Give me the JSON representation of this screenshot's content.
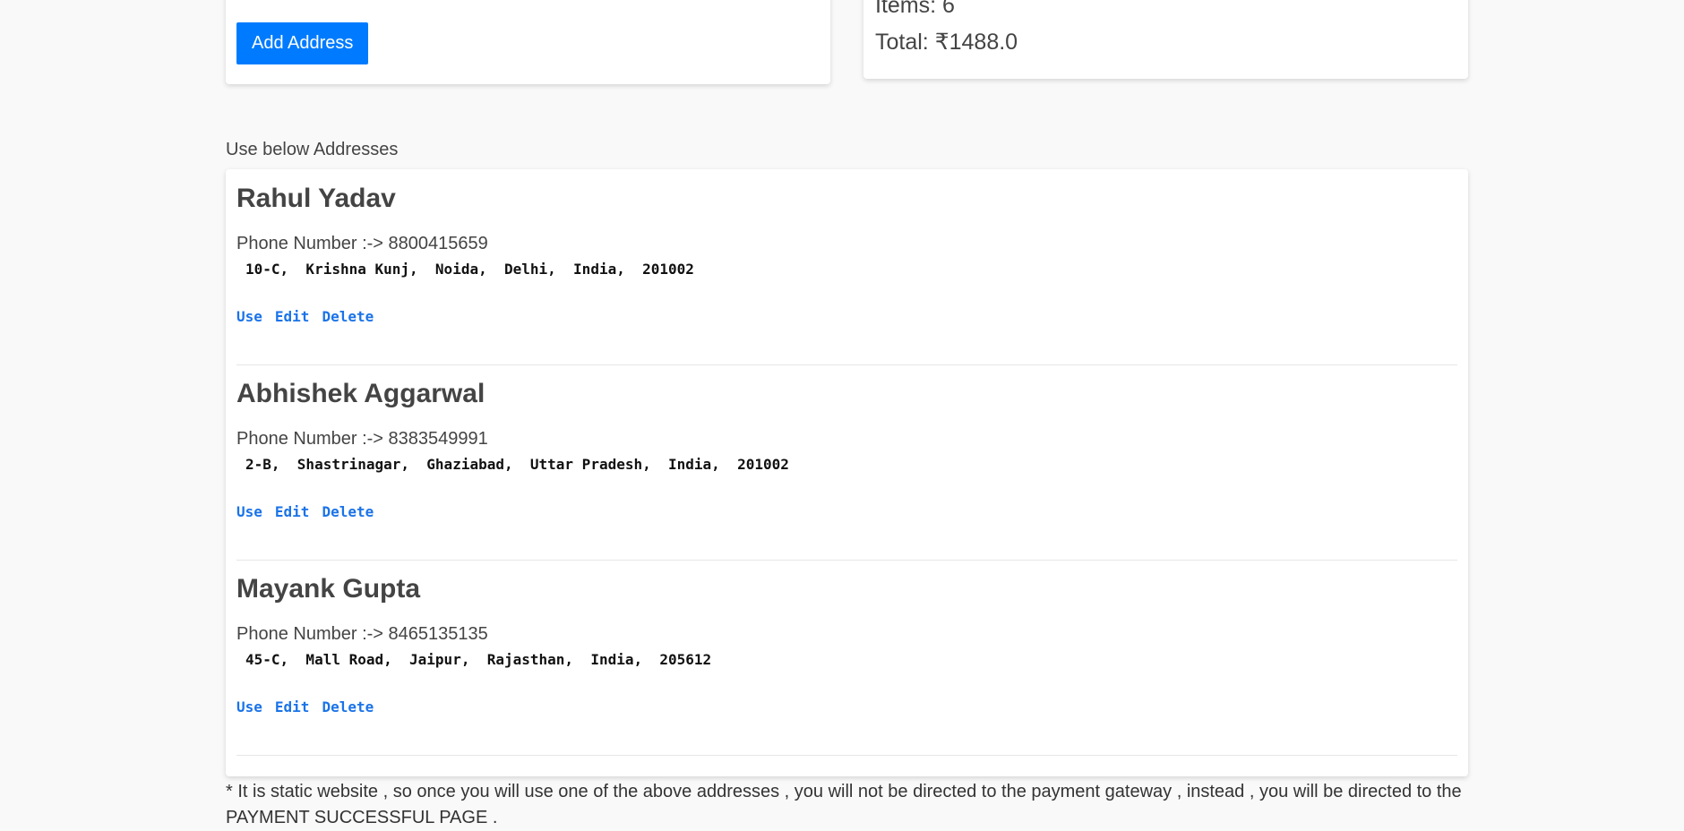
{
  "checkout": {
    "add_address_label": "Add Address",
    "items_label": "Items: 6",
    "total_label": "Total: ₹1488.0"
  },
  "addresses_heading": "Use below Addresses",
  "addresses": [
    {
      "name": "Rahul Yadav",
      "phone": "Phone Number :-> 8800415659",
      "address_line": "10-C,  Krishna Kunj,  Noida,  Delhi,  India,  201002",
      "use": "Use",
      "edit": "Edit",
      "delete": "Delete"
    },
    {
      "name": "Abhishek Aggarwal",
      "phone": "Phone Number :-> 8383549991",
      "address_line": "2-B,  Shastrinagar,  Ghaziabad,  Uttar Pradesh,  India,  201002",
      "use": "Use",
      "edit": "Edit",
      "delete": "Delete"
    },
    {
      "name": "Mayank Gupta",
      "phone": "Phone Number :-> 8465135135",
      "address_line": "45-C,  Mall Road,  Jaipur,  Rajasthan,  India,  205612",
      "use": "Use",
      "edit": "Edit",
      "delete": "Delete"
    }
  ],
  "note": "* It is static website , so once you will use one of the above addresses , you will not be directed to the payment gateway , instead , you will be directed to the PAYMENT SUCCESSFUL PAGE .",
  "colors": {
    "primary": "#007bff",
    "link": "#1a73e8",
    "background": "#f9f9f9"
  }
}
